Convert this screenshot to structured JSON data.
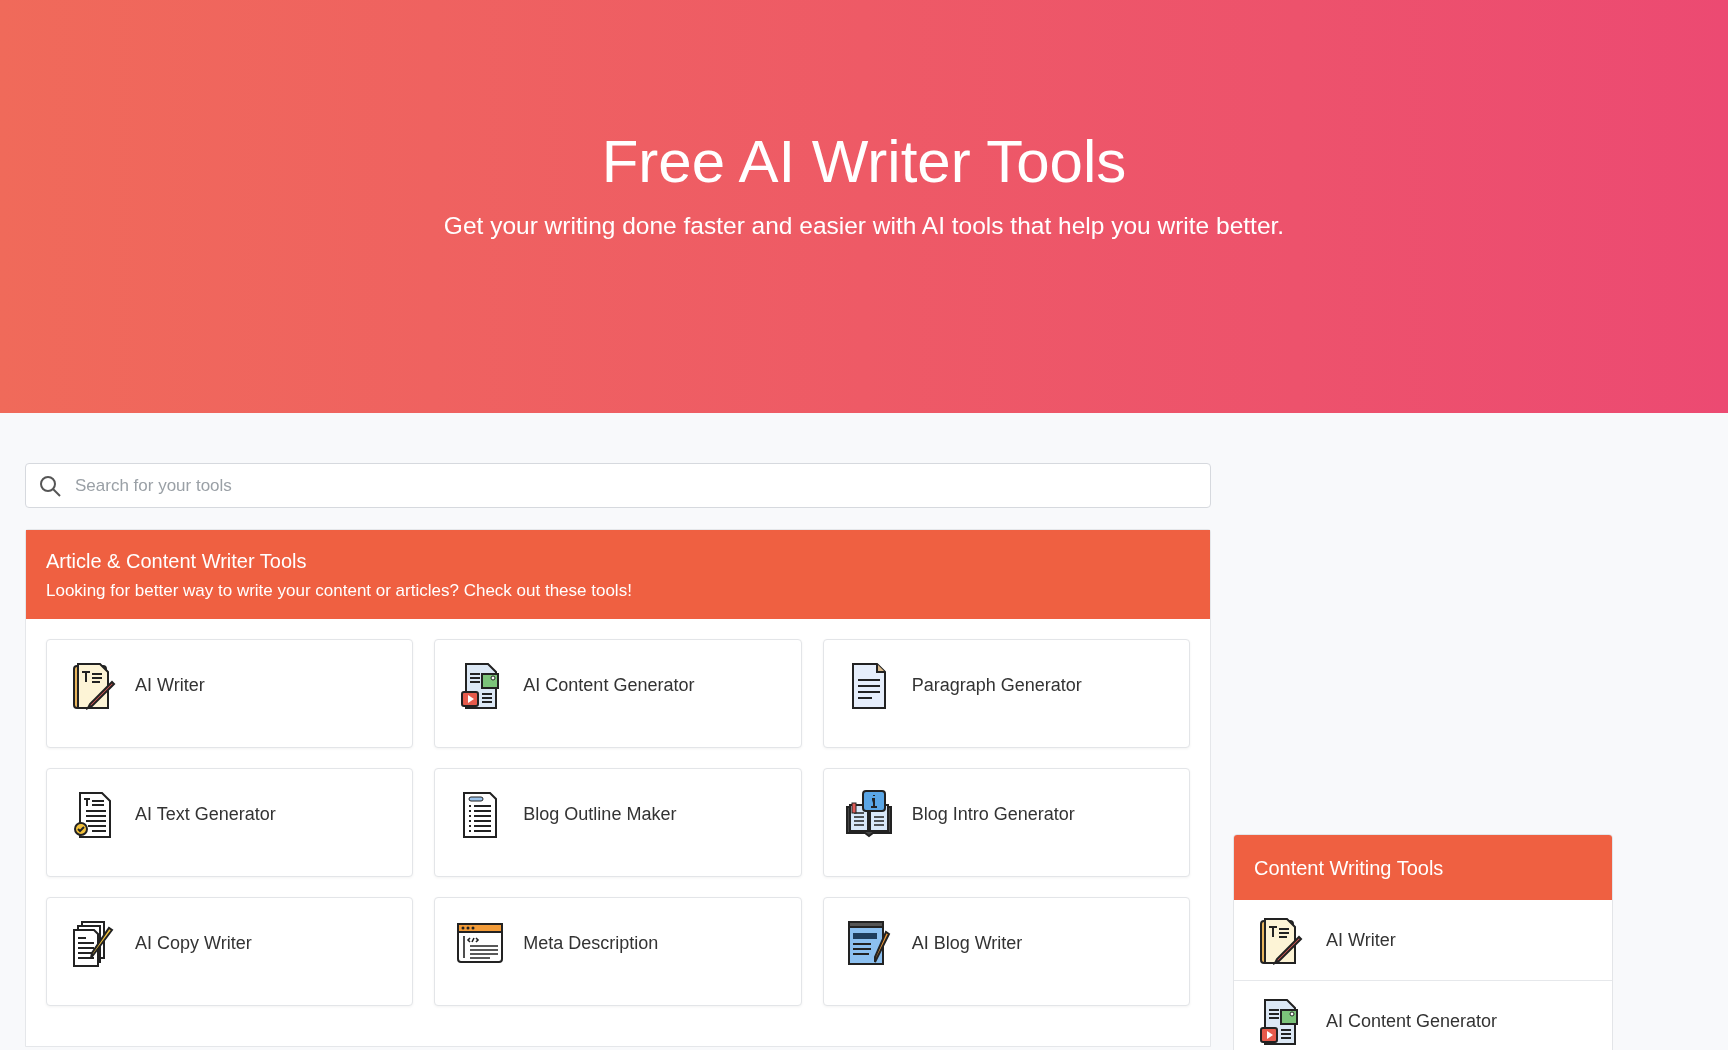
{
  "hero": {
    "title": "Free AI Writer Tools",
    "subtitle": "Get your writing done faster and easier with AI tools that help you write better."
  },
  "search": {
    "placeholder": "Search for your tools"
  },
  "section": {
    "title": "Article & Content Writer Tools",
    "description": "Looking for better way to write your content or articles? Check out these tools!",
    "tools": [
      {
        "label": "AI Writer"
      },
      {
        "label": "AI Content Generator"
      },
      {
        "label": "Paragraph Generator"
      },
      {
        "label": "AI Text Generator"
      },
      {
        "label": "Blog Outline Maker"
      },
      {
        "label": "Blog Intro Generator"
      },
      {
        "label": "AI Copy Writer"
      },
      {
        "label": "Meta Description"
      },
      {
        "label": "AI Blog Writer"
      }
    ]
  },
  "sidebar": {
    "title": "Content Writing Tools",
    "items": [
      {
        "label": "AI Writer"
      },
      {
        "label": "AI Content Generator"
      }
    ]
  }
}
